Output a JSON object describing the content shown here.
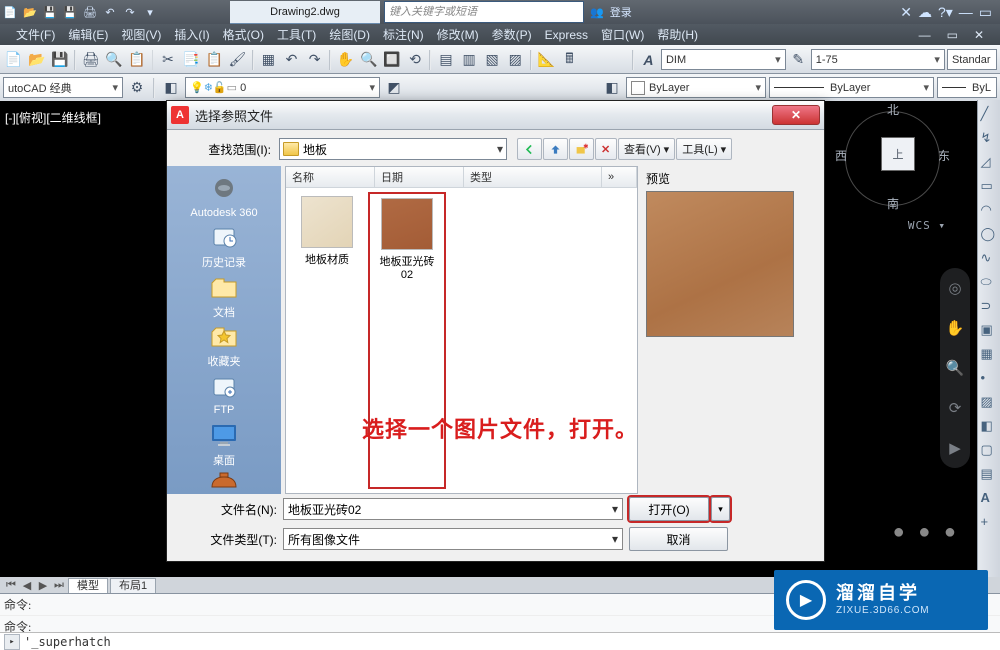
{
  "titlebar": {
    "doc": "Drawing2.dwg",
    "keyword_placeholder": "键入关键字或短语",
    "login": "登录"
  },
  "menus": [
    "文件(F)",
    "编辑(E)",
    "视图(V)",
    "插入(I)",
    "格式(O)",
    "工具(T)",
    "绘图(D)",
    "标注(N)",
    "修改(M)",
    "参数(P)",
    "Express",
    "窗口(W)",
    "帮助(H)"
  ],
  "toolrow2": {
    "dim": "DIM",
    "scale": "1-75",
    "style": "Standar"
  },
  "layerrow": {
    "workspace": "utoCAD 经典",
    "layernum": "0",
    "bylayer": "ByLayer",
    "bylayer2": "ByLayer",
    "bylayer3": "ByL"
  },
  "viewlabel": "[-][俯视][二维线框]",
  "compass": {
    "n": "北",
    "s": "南",
    "e": "东",
    "w": "西",
    "face": "上",
    "wcs": "WCS ▾"
  },
  "dialog": {
    "title": "选择参照文件",
    "look_label": "查找范围(I):",
    "folder": "地板",
    "toolbar": {
      "view": "查看(V)",
      "tools": "工具(L)"
    },
    "columns": {
      "name": "名称",
      "date": "日期",
      "type": "类型",
      "more": "»"
    },
    "places": [
      {
        "id": "a360",
        "label": "Autodesk 360"
      },
      {
        "id": "history",
        "label": "历史记录"
      },
      {
        "id": "docs",
        "label": "文档"
      },
      {
        "id": "fav",
        "label": "收藏夹"
      },
      {
        "id": "ftp",
        "label": "FTP"
      },
      {
        "id": "desktop",
        "label": "桌面"
      }
    ],
    "files": [
      {
        "id": "mat",
        "label": "地板材质",
        "selected": false
      },
      {
        "id": "tile02",
        "label": "地板亚光砖02",
        "selected": true
      }
    ],
    "preview_label": "预览",
    "filename_label": "文件名(N):",
    "filename_value": "地板亚光砖02",
    "filetype_label": "文件类型(T):",
    "filetype_value": "所有图像文件",
    "open": "打开(O)",
    "cancel": "取消"
  },
  "hint": "选择一个图片文件，打开。",
  "tabs": {
    "model": "模型",
    "layout": "布局1"
  },
  "cmd": {
    "line1": "命令:",
    "line2": "命令:",
    "prompt": "'_superhatch"
  },
  "watermark": {
    "big": "溜溜自学",
    "small": "ZIXUE.3D66.COM"
  }
}
